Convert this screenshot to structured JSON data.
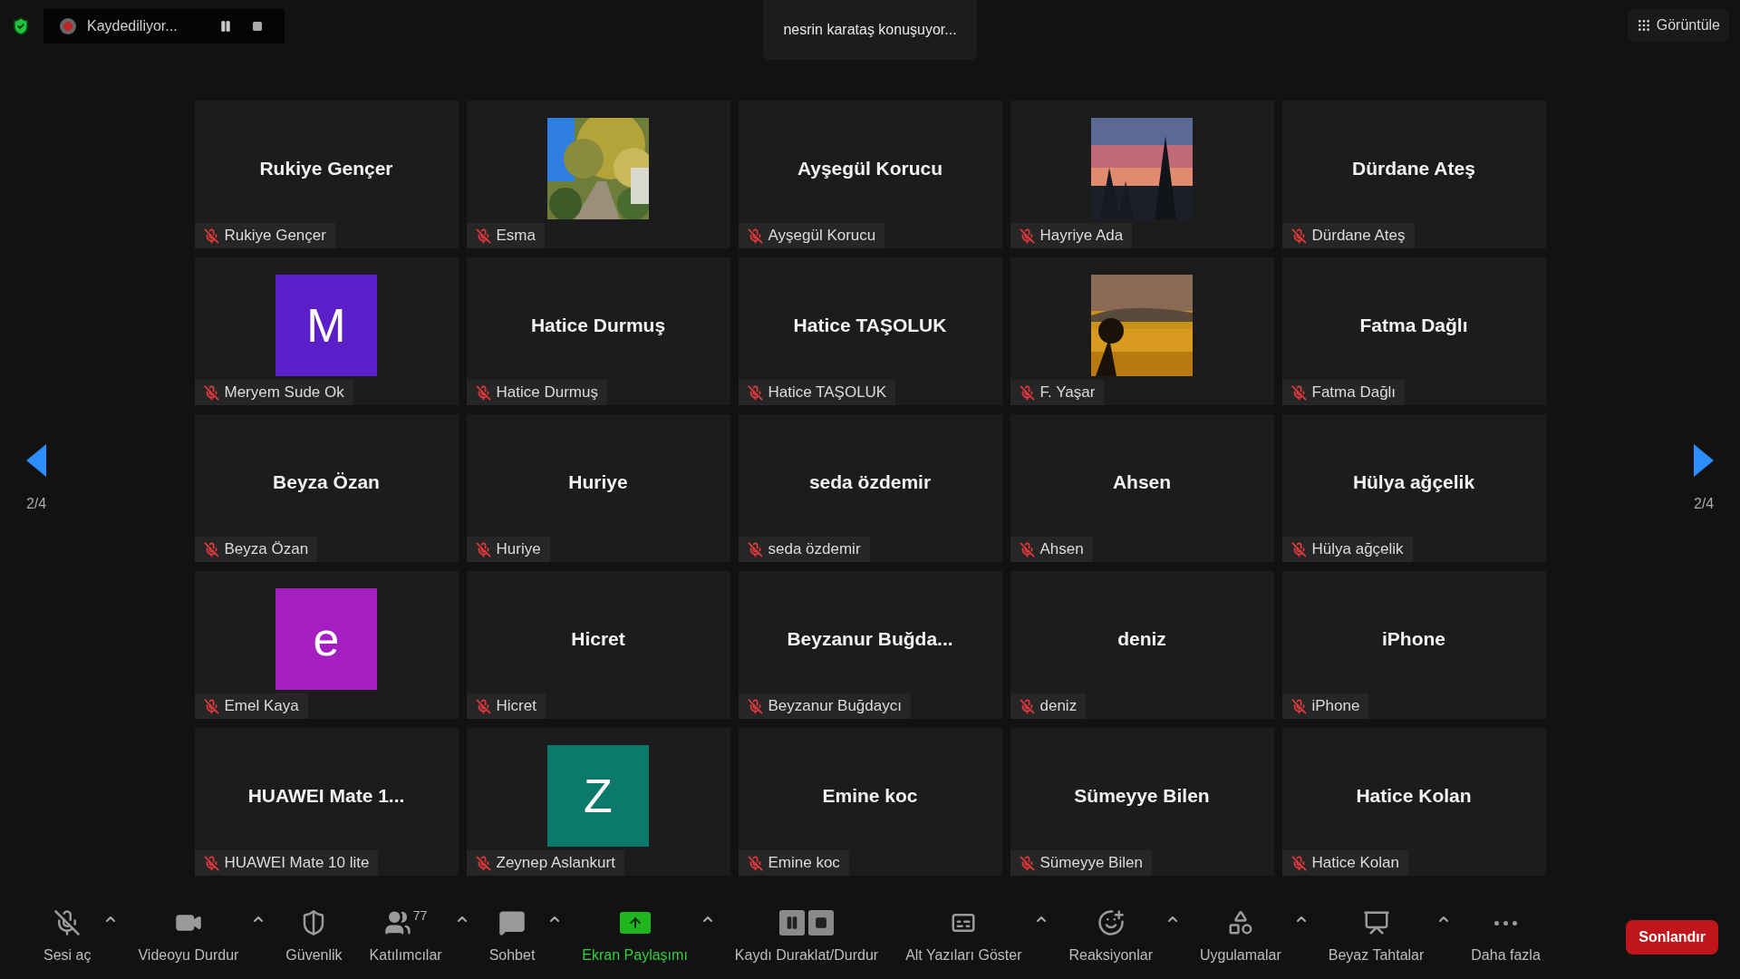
{
  "top_bar": {
    "recording": {
      "label": "Kaydediliyor..."
    },
    "speaker_banner": "nesrin karataş konuşuyor...",
    "view_button": "Görüntüle"
  },
  "pager": {
    "left": "2/4",
    "right": "2/4"
  },
  "tiles": [
    {
      "kind": "name",
      "title": "Rukiye Gençer",
      "label": "Rukiye Gençer",
      "muted": true
    },
    {
      "kind": "picture",
      "label": "Esma",
      "muted": true
    },
    {
      "kind": "name",
      "title": "Ayşegül Korucu",
      "label": "Ayşegül Korucu",
      "muted": true
    },
    {
      "kind": "picture",
      "label": "Hayriye Ada",
      "muted": true
    },
    {
      "kind": "name",
      "title": "Dürdane Ateş",
      "label": "Dürdane Ateş",
      "muted": true
    },
    {
      "kind": "letter",
      "letter": "M",
      "color": "#5a1fc8",
      "label": "Meryem Sude Ok",
      "muted": true
    },
    {
      "kind": "name",
      "title": "Hatice Durmuş",
      "label": "Hatice Durmuş",
      "muted": true
    },
    {
      "kind": "name",
      "title": "Hatice TAŞOLUK",
      "label": "Hatice TAŞOLUK",
      "muted": true
    },
    {
      "kind": "picture",
      "label": "F. Yaşar",
      "muted": true
    },
    {
      "kind": "name",
      "title": "Fatma Dağlı",
      "label": "Fatma Dağlı",
      "muted": true
    },
    {
      "kind": "name",
      "title": "Beyza Özan",
      "label": "Beyza Özan",
      "muted": true
    },
    {
      "kind": "name",
      "title": "Huriye",
      "label": "Huriye",
      "muted": true
    },
    {
      "kind": "name",
      "title": "seda özdemir",
      "label": "seda özdemir",
      "muted": true
    },
    {
      "kind": "name",
      "title": "Ahsen",
      "label": "Ahsen",
      "muted": true
    },
    {
      "kind": "name",
      "title": "Hülya ağçelik",
      "label": "Hülya ağçelik",
      "muted": true
    },
    {
      "kind": "letter",
      "letter": "e",
      "color": "#a51fc0",
      "label": "Emel Kaya",
      "muted": true
    },
    {
      "kind": "name",
      "title": "Hicret",
      "label": "Hicret",
      "muted": true
    },
    {
      "kind": "name",
      "title": "Beyzanur  Buğda...",
      "label": "Beyzanur Buğdaycı",
      "muted": true
    },
    {
      "kind": "name",
      "title": "deniz",
      "label": "deniz",
      "muted": true
    },
    {
      "kind": "name",
      "title": "iPhone",
      "label": "iPhone",
      "muted": true
    },
    {
      "kind": "name",
      "title": "HUAWEI Mate 1...",
      "label": "HUAWEI Mate 10 lite",
      "muted": true
    },
    {
      "kind": "letter",
      "letter": "Z",
      "color": "#0b7a6b",
      "label": "Zeynep Aslankurt",
      "muted": true
    },
    {
      "kind": "name",
      "title": "Emine koc",
      "label": "Emine koc",
      "muted": true
    },
    {
      "kind": "name",
      "title": "Sümeyye Bilen",
      "label": "Sümeyye Bilen",
      "muted": true
    },
    {
      "kind": "name",
      "title": "Hatice Kolan",
      "label": "Hatice Kolan",
      "muted": true
    }
  ],
  "toolbar": [
    {
      "kind": "mic-off",
      "label": "Sesi aç",
      "menu": true
    },
    {
      "kind": "video",
      "label": "Videoyu Durdur",
      "menu": true
    },
    {
      "kind": "security",
      "label": "Güvenlik",
      "menu": false
    },
    {
      "kind": "participants",
      "label": "Katılımcılar",
      "count": "77",
      "menu": true
    },
    {
      "kind": "chat",
      "label": "Sohbet",
      "menu": true
    },
    {
      "kind": "share",
      "label": "Ekran Paylaşımı",
      "menu": true
    },
    {
      "kind": "record",
      "label": "Kaydı Duraklat/Durdur",
      "menu": false
    },
    {
      "kind": "captions",
      "label": "Alt Yazıları Göster",
      "menu": true
    },
    {
      "kind": "reactions",
      "label": "Reaksiyonlar",
      "menu": true
    },
    {
      "kind": "apps",
      "label": "Uygulamalar",
      "menu": true
    },
    {
      "kind": "whiteboard",
      "label": "Beyaz Tahtalar",
      "menu": true
    },
    {
      "kind": "more",
      "label": "Daha fazla",
      "menu": false
    }
  ],
  "end_button": "Sonlandır"
}
